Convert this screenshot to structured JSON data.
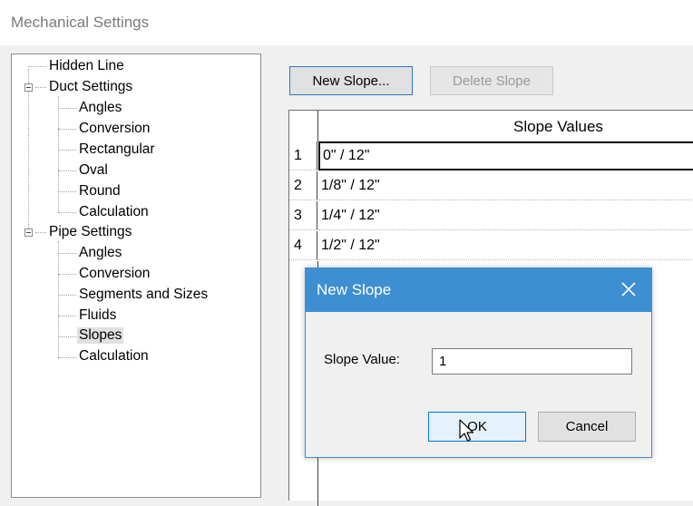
{
  "window": {
    "title": "Mechanical Settings"
  },
  "tree": {
    "hidden_line": "Hidden Line",
    "duct_settings": {
      "label": "Duct Settings",
      "children": [
        "Angles",
        "Conversion",
        "Rectangular",
        "Oval",
        "Round",
        "Calculation"
      ]
    },
    "pipe_settings": {
      "label": "Pipe Settings",
      "children": [
        "Angles",
        "Conversion",
        "Segments and Sizes",
        "Fluids",
        "Slopes",
        "Calculation"
      ],
      "selected": "Slopes"
    }
  },
  "toolbar": {
    "new_slope_label": "New Slope...",
    "delete_slope_label": "Delete Slope"
  },
  "table": {
    "column_header": "Slope Values",
    "rows": [
      {
        "num": "1",
        "value": "0\" / 12\""
      },
      {
        "num": "2",
        "value": "1/8\" / 12\""
      },
      {
        "num": "3",
        "value": "1/4\" / 12\""
      },
      {
        "num": "4",
        "value": "1/2\" / 12\""
      }
    ]
  },
  "dialog": {
    "title": "New Slope",
    "slope_value_label": "Slope Value:",
    "slope_value": "1",
    "ok_label": "OK",
    "cancel_label": "Cancel",
    "title_bar_color": "#3d8fd1"
  },
  "icons": {
    "close": "close-icon",
    "collapse": "collapse-icon",
    "cursor": "mouse-pointer-icon"
  }
}
